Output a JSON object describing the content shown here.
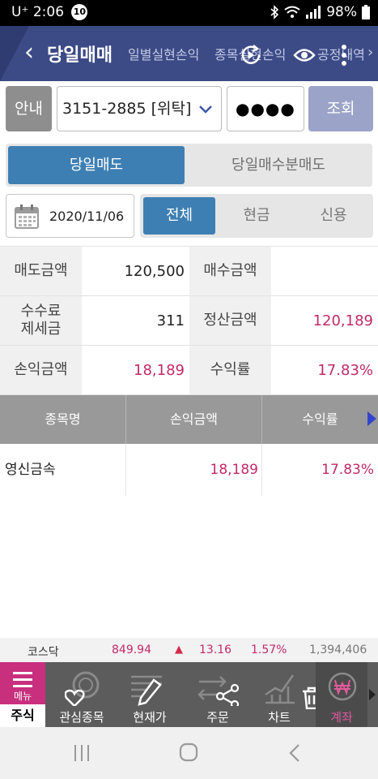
{
  "status_bar": {
    "carrier": "U⁺",
    "time": "2:06",
    "notification_count": "10",
    "battery": "98%"
  },
  "header": {
    "title": "당일매매",
    "tabs": [
      "일별실현손익",
      "종목실현손익",
      "공정내역"
    ]
  },
  "account": {
    "guide_label": "안내",
    "account_value": "3151-2885 [위탁]",
    "password_mask": "●●●●",
    "query_label": "조회"
  },
  "segments": {
    "active": "당일매도",
    "inactive": "당일매수분매도"
  },
  "date": "2020/11/06",
  "filters": [
    "전체",
    "현금",
    "신용"
  ],
  "summary": {
    "sell_amount_label": "매도금액",
    "sell_amount": "120,500",
    "buy_amount_label": "매수금액",
    "buy_amount": "",
    "fee_label_1": "수수료",
    "fee_label_2": "제세금",
    "fee": "311",
    "settle_label": "정산금액",
    "settle": "120,189",
    "pnl_label": "손익금액",
    "pnl": "18,189",
    "rate_label": "수익률",
    "rate": "17.83%"
  },
  "table": {
    "headers": [
      "종목명",
      "손익금액",
      "수익률"
    ],
    "rows": [
      {
        "name": "영신금속",
        "pnl": "18,189",
        "rate": "17.83%"
      }
    ]
  },
  "market": {
    "index": "코스닥",
    "value": "849.94",
    "arrow": "▲",
    "change": "13.16",
    "percent": "1.57%",
    "volume": "1,394,406"
  },
  "bottom_nav": {
    "menu_label": "메뉴",
    "menu_sub": "주식",
    "items": [
      "관심종목",
      "현재가",
      "주문",
      "차트",
      "계좌"
    ]
  },
  "colors": {
    "header_bg": "#3c4b86",
    "accent_blue": "#3e7fb3",
    "profit_red": "#c12a6a",
    "menu_magenta": "#c8307e"
  }
}
